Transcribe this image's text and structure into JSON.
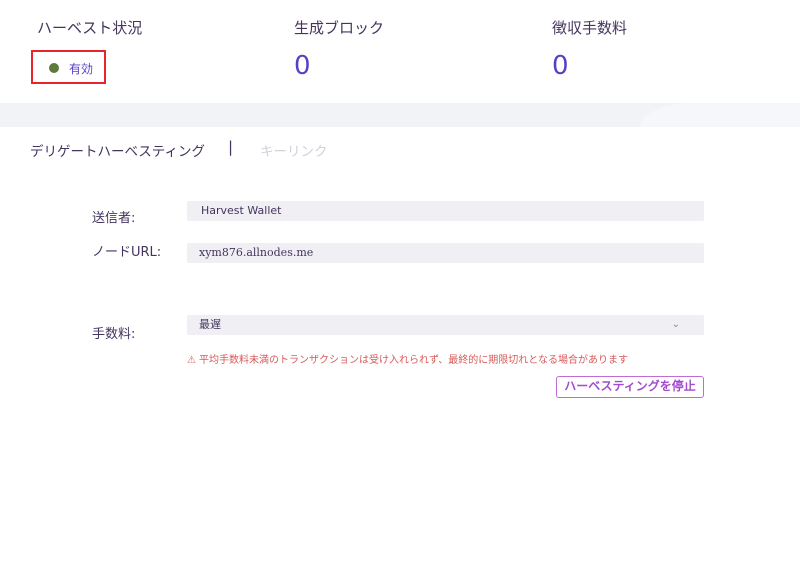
{
  "summary": {
    "harvest_status": {
      "title": "ハーベスト状況",
      "value": "有効",
      "status_color": "#5b7a3c"
    },
    "blocks": {
      "title": "生成ブロック",
      "value": "0"
    },
    "fees": {
      "title": "徴収手数料",
      "value": "0"
    }
  },
  "tabs": [
    {
      "label": "デリゲートハーベスティング",
      "active": true
    },
    {
      "label": "キーリンク",
      "active": false
    }
  ],
  "tab_separator": "|",
  "form": {
    "sender": {
      "label": "送信者:",
      "value": "Harvest Wallet"
    },
    "node_url": {
      "label": "ノードURL:",
      "value": "xym876.allnodes.me"
    },
    "fee": {
      "label": "手数料:",
      "value": "最遅"
    }
  },
  "warning": {
    "icon": "warning-triangle-icon",
    "icon_glyph": "⚠",
    "text": "平均手数料未満のトランザクションは受け入れられず、最終的に期限切れとなる場合があります"
  },
  "stop_button": {
    "label": "ハーベスティングを停止"
  },
  "colors": {
    "accent": "#5b3ec8",
    "highlight_border": "#e8252b",
    "button_border": "#c06bd6",
    "warning": "#d85a5a"
  }
}
